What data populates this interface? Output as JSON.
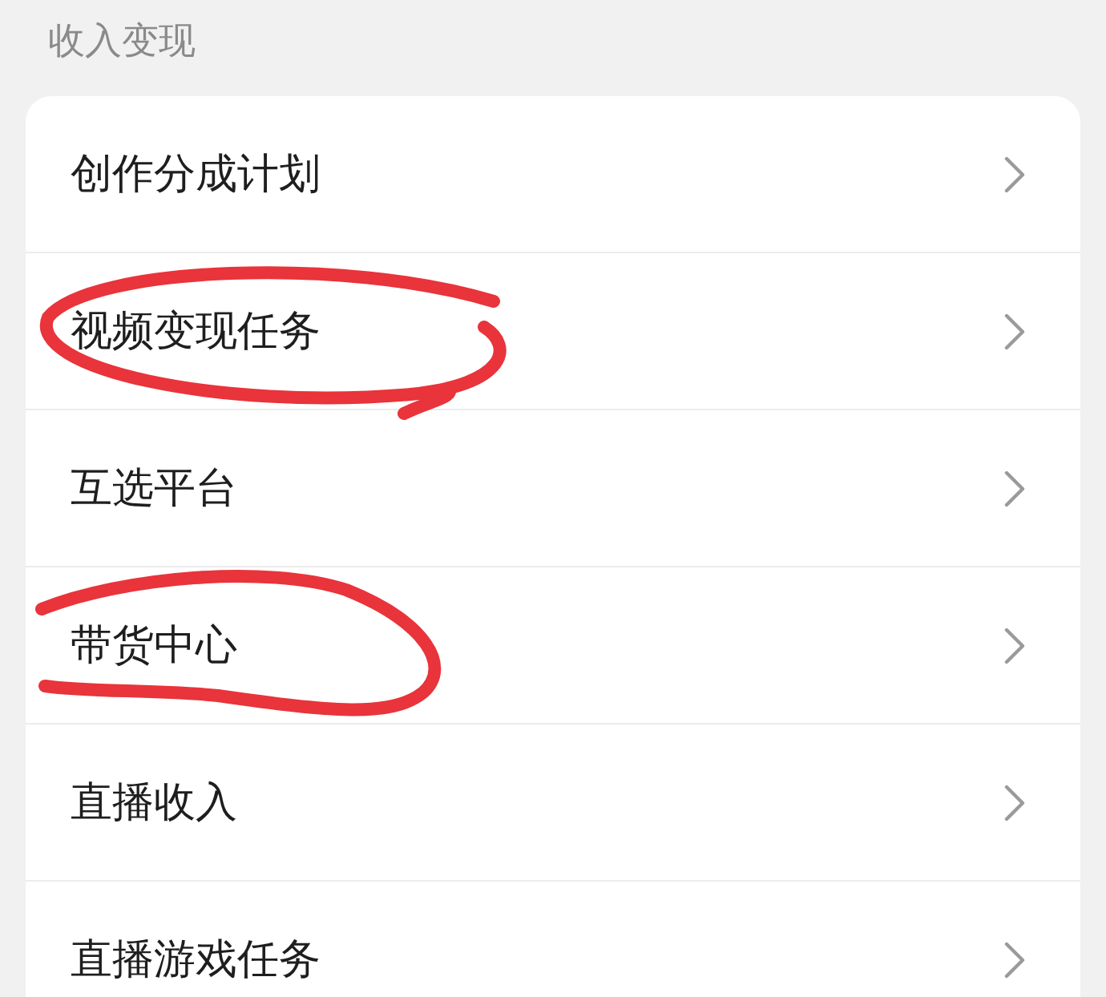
{
  "section_title": "收入变现",
  "items": [
    {
      "label": "创作分成计划",
      "circled": false
    },
    {
      "label": "视频变现任务",
      "circled": true
    },
    {
      "label": "互选平台",
      "circled": false
    },
    {
      "label": "带货中心",
      "circled": true
    },
    {
      "label": "直播收入",
      "circled": false
    },
    {
      "label": "直播游戏任务",
      "circled": false
    }
  ]
}
